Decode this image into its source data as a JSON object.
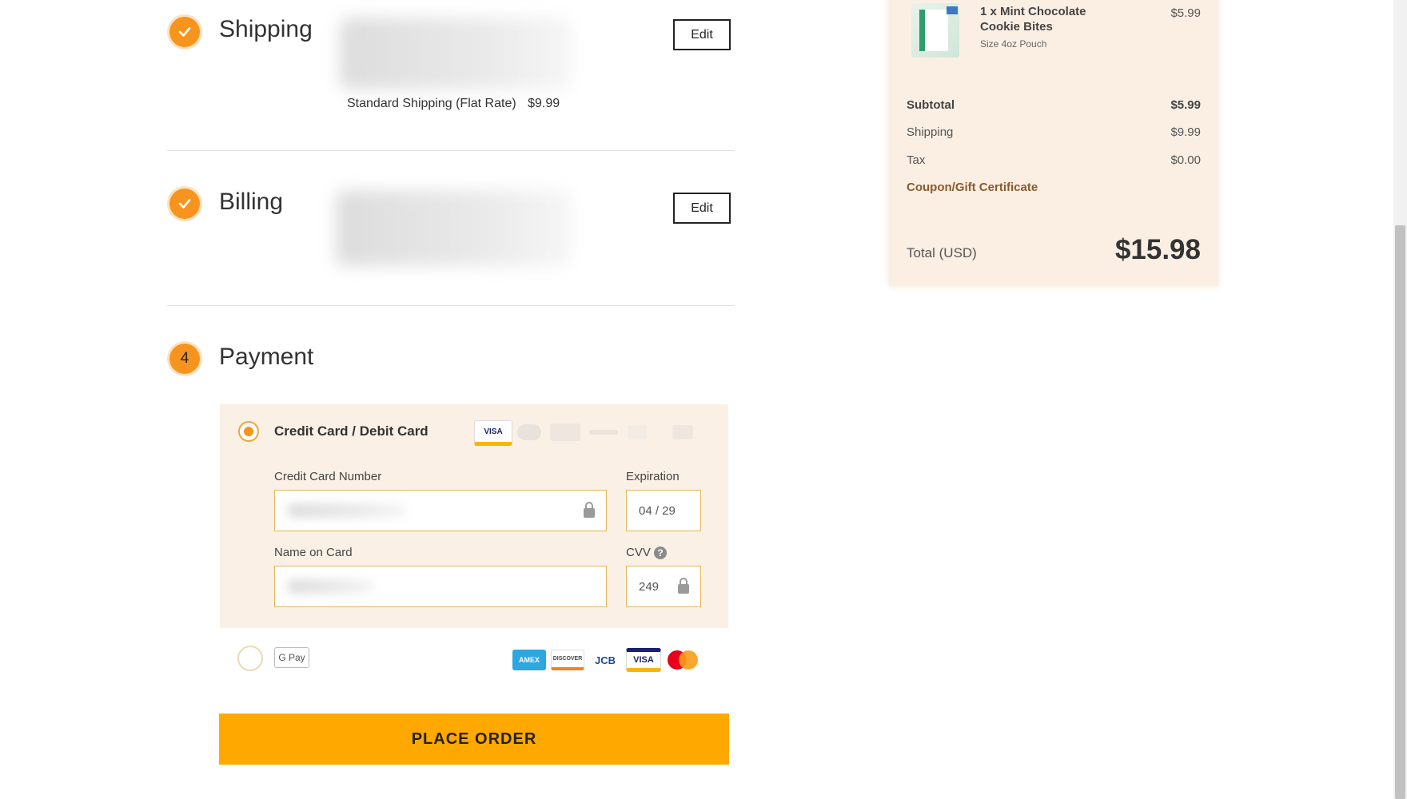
{
  "steps": {
    "shipping": {
      "title": "Shipping",
      "edit": "Edit",
      "method": "Standard Shipping (Flat Rate)",
      "price": "$9.99"
    },
    "billing": {
      "title": "Billing",
      "edit": "Edit"
    },
    "payment": {
      "number": "4",
      "title": "Payment"
    }
  },
  "payment": {
    "card_option_label": "Credit Card / Debit Card",
    "card_number_label": "Credit Card Number",
    "expiration_label": "Expiration",
    "expiration_value": "04 / 29",
    "name_label": "Name on Card",
    "cvv_label": "CVV",
    "cvv_value": "249",
    "gpay_label": "G Pay",
    "card_brands": [
      "AMEX",
      "DISCOVER",
      "JCB",
      "VISA",
      "MASTERCARD"
    ],
    "visa_label": "VISA",
    "amex_label": "AMEX",
    "discover_label": "DISCOVER",
    "jcb_label": "JCB"
  },
  "place_order": "PLACE ORDER",
  "summary": {
    "item_title": "1 x Mint Chocolate Cookie Bites",
    "item_size": "Size 4oz Pouch",
    "item_price": "$5.99",
    "subtotal_label": "Subtotal",
    "subtotal": "$5.99",
    "shipping_label": "Shipping",
    "shipping": "$9.99",
    "tax_label": "Tax",
    "tax": "$0.00",
    "coupon_label": "Coupon/Gift Certificate",
    "total_label": "Total (USD)",
    "total": "$15.98"
  },
  "colors": {
    "accent": "#f7941d",
    "button": "#ffa800",
    "panel_bg": "#fbefe4",
    "coupon_link": "#8a5a2b"
  }
}
